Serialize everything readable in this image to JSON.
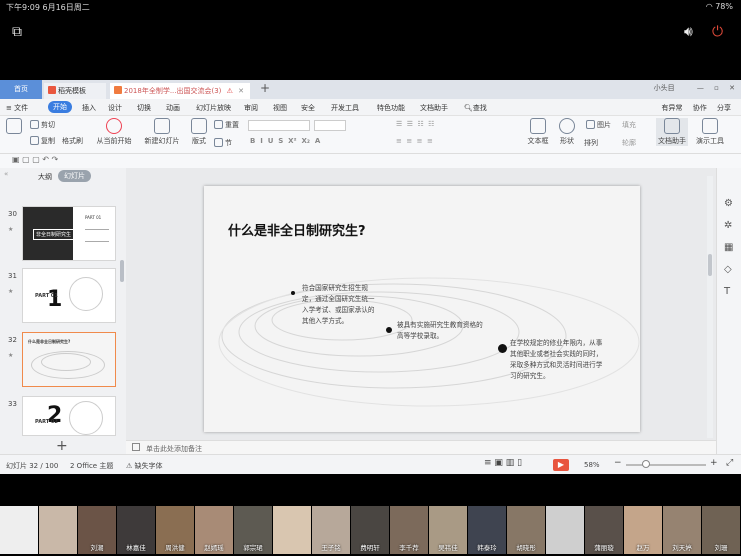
{
  "status": {
    "time_date": "下午9:09  6月16日周二",
    "battery": "78%"
  },
  "tabs": {
    "home": "首页",
    "template": "稻壳模板",
    "doc": "2018年全制学...出国交流会(3)"
  },
  "user": {
    "name": "小头目"
  },
  "menu": {
    "items": [
      "文件",
      "开始",
      "插入",
      "设计",
      "切换",
      "动画",
      "幻灯片放映",
      "审阅",
      "视图",
      "安全",
      "开发工具",
      "特色功能",
      "文档助手",
      "查找"
    ],
    "right": [
      "有异常",
      "协作",
      "分享"
    ]
  },
  "ribbon": {
    "cut": "剪切",
    "copy": "复制",
    "format_painter": "格式刷",
    "play_from_current": "从当前开始",
    "new_slide": "新建幻灯片",
    "layout": "版式",
    "section": "节",
    "reset": "重置",
    "text_box": "文本框",
    "shapes": "形状",
    "arrange": "排列",
    "picture": "图片",
    "fill": "填充",
    "outline": "轮廓",
    "doc_helper": "文档助手",
    "presentation_tools": "演示工具"
  },
  "panel": {
    "outline_tab": "大纲",
    "slides_tab": "幻灯片"
  },
  "thumbnails": [
    {
      "num": "30",
      "title": "非全日制研究生",
      "part": "PART 01"
    },
    {
      "num": "31",
      "part": "PART 01",
      "big": "1"
    },
    {
      "num": "32",
      "title": "什么是非全日制研究生?"
    },
    {
      "num": "33",
      "part": "PART 02",
      "big": "2"
    }
  ],
  "slide": {
    "title": "什么是非全日制研究生?",
    "point1": "符合国家研究生招生规定，通过全国研究生统一入学考试、或国家承认的其他入学方式。",
    "point2": "被具有实施研究生教育资格的高等学校录取。",
    "point3": "在学校规定的修业年限内，从事其他职业或者社会实践的同时，采取多种方式和灵活时间进行学习的研究生。"
  },
  "notes": {
    "placeholder": "单击此处添加备注"
  },
  "statusbar": {
    "slide_count": "幻灯片 32 / 100",
    "theme": "2  Office 主题",
    "missing_font": "缺失字体",
    "zoom": "58%"
  },
  "participants": [
    "",
    "",
    "刘潮",
    "林嘉佳",
    "周洪健",
    "赵嫣瑶",
    "郭宗珺",
    "",
    "王子铭",
    "费明轩",
    "李千荐",
    "吴祎佳",
    "韩泰玲",
    "胡晓彤",
    "",
    "蒲丽璇",
    "赵万",
    "刘天婷",
    "刘珊"
  ],
  "colors": {
    "accent": "#3a7de0",
    "tab_home": "#5b8fd9",
    "selected_thumb": "#f08a4b",
    "play": "#e8553f"
  }
}
